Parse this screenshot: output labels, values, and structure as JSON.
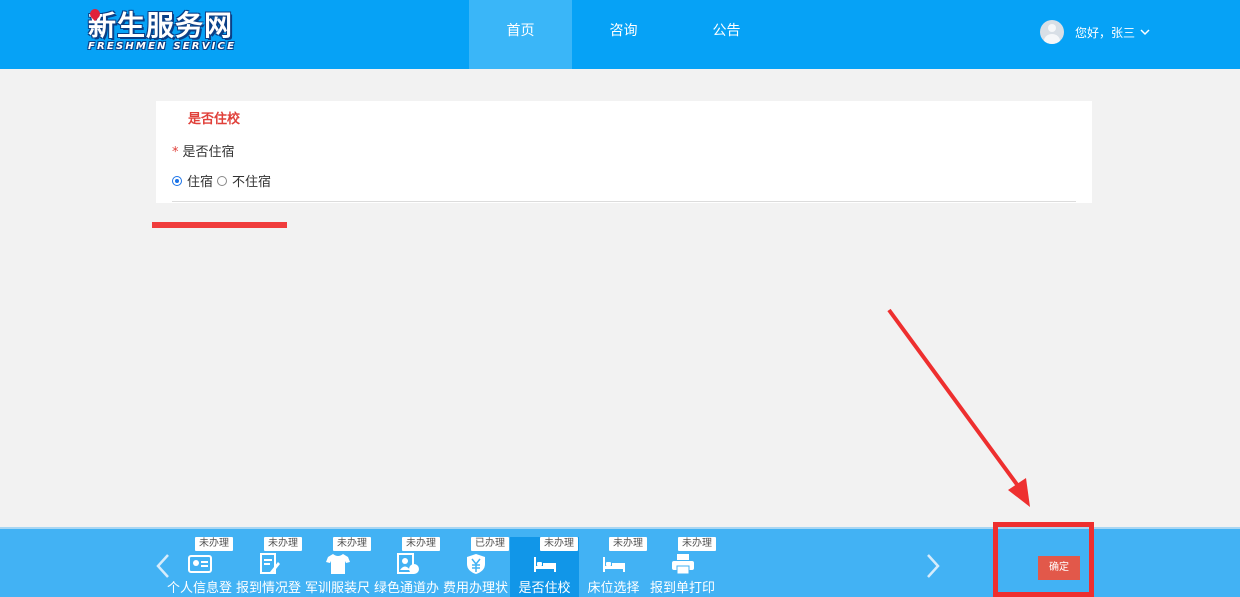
{
  "header": {
    "logo_main": "新生服务网",
    "logo_sub": "FRESHMEN SERVICE",
    "nav": [
      {
        "label": "首页",
        "active": true
      },
      {
        "label": "咨询",
        "active": false
      },
      {
        "label": "公告",
        "active": false
      }
    ],
    "user_greeting": "您好，张三"
  },
  "card": {
    "title": "是否住校",
    "field_label": "是否住宿",
    "required_mark": "*",
    "options": [
      {
        "label": "住宿",
        "checked": true
      },
      {
        "label": "不住宿",
        "checked": false
      }
    ]
  },
  "steps": [
    {
      "label": "个人信息登",
      "status": "未办理",
      "icon": "id-card-icon",
      "active": false
    },
    {
      "label": "报到情况登",
      "status": "未办理",
      "icon": "edit-form-icon",
      "active": false
    },
    {
      "label": "军训服装尺",
      "status": "未办理",
      "icon": "tshirt-icon",
      "active": false
    },
    {
      "label": "绿色通道办",
      "status": "未办理",
      "icon": "user-card-icon",
      "active": false
    },
    {
      "label": "费用办理状",
      "status": "已办理",
      "icon": "yuan-shield-icon",
      "active": false
    },
    {
      "label": "是否住校",
      "status": "未办理",
      "icon": "bed-icon",
      "active": true
    },
    {
      "label": "床位选择",
      "status": "未办理",
      "icon": "bed-icon",
      "active": false
    },
    {
      "label": "报到单打印",
      "status": "未办理",
      "icon": "printer-icon",
      "active": false
    }
  ],
  "confirm_label": "确定",
  "colors": {
    "header_bg": "#06a2f6",
    "bottom_bar_bg": "#42b2f4",
    "annotation_red": "#ee2f2f",
    "confirm_bg": "#e2584a"
  }
}
